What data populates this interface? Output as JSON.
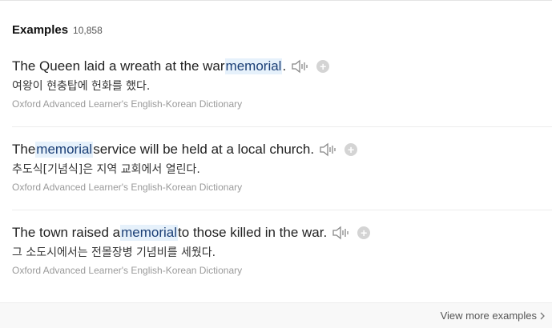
{
  "header": {
    "title": "Examples",
    "count": "10,858"
  },
  "examples": [
    {
      "before": "The Queen laid a wreath at the war ",
      "highlight": "memorial",
      "after": ".",
      "translation": "여왕이 현충탑에 헌화를 했다.",
      "source": "Oxford Advanced Learner's English-Korean Dictionary"
    },
    {
      "before": "The ",
      "highlight": "memorial",
      "after": " service will be held at a local church.",
      "translation": "추도식[기념식]은 지역 교회에서 열린다.",
      "source": "Oxford Advanced Learner's English-Korean Dictionary"
    },
    {
      "before": "The town raised a ",
      "highlight": "memorial",
      "after": " to those killed in the war.",
      "translation": "그 소도시에서는 전몰장병 기념비를 세웠다.",
      "source": "Oxford Advanced Learner's English-Korean Dictionary"
    }
  ],
  "footer": {
    "more_label": "View more examples"
  },
  "icons": {
    "speaker": "speaker-icon",
    "add": "plus-circle-icon",
    "chevron": "chevron-right-icon"
  },
  "colors": {
    "highlight_bg": "#e6f1fb",
    "source_text": "#9a9a9a"
  }
}
